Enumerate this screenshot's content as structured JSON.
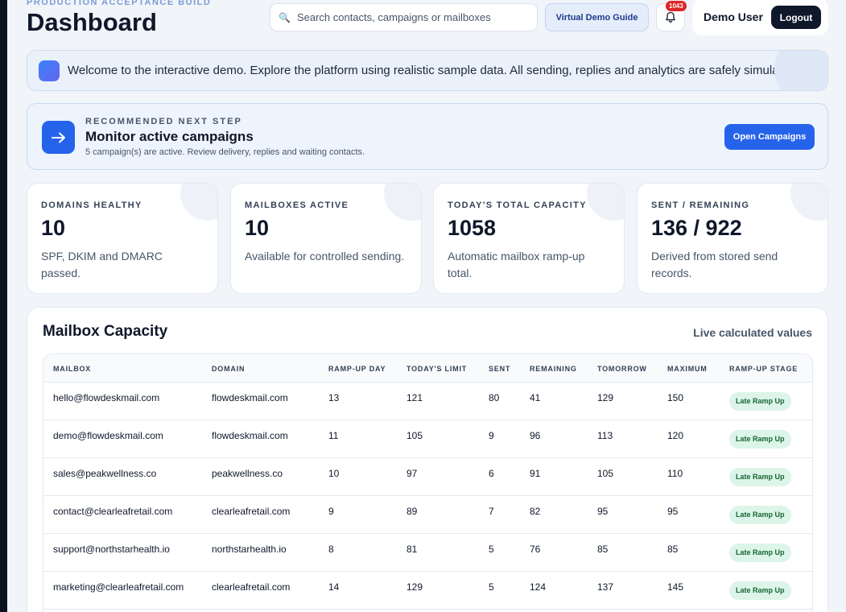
{
  "header": {
    "eyebrow": "PRODUCTION ACCEPTANCE BUILD",
    "title": "Dashboard",
    "search_placeholder": "Search contacts, campaigns or mailboxes",
    "guide_label": "Virtual Demo Guide",
    "notification_count": "1043",
    "user_name": "Demo User",
    "logout_label": "Logout"
  },
  "welcome": {
    "text": "Welcome to the interactive demo. Explore the platform using realistic sample data. All sending, replies and analytics are safely simulated."
  },
  "recommend": {
    "eyebrow": "RECOMMENDED NEXT STEP",
    "title": "Monitor active campaigns",
    "subtitle": "5 campaign(s) are active. Review delivery, replies and waiting contacts.",
    "button_label": "Open Campaigns"
  },
  "stats": [
    {
      "label": "DOMAINS HEALTHY",
      "value": "10",
      "desc": "SPF, DKIM and DMARC passed."
    },
    {
      "label": "MAILBOXES ACTIVE",
      "value": "10",
      "desc": "Available for controlled sending."
    },
    {
      "label": "TODAY'S TOTAL CAPACITY",
      "value": "1058",
      "desc": "Automatic mailbox ramp-up total."
    },
    {
      "label": "SENT / REMAINING",
      "value": "136 / 922",
      "desc": "Derived from stored send records."
    }
  ],
  "capacity": {
    "title": "Mailbox Capacity",
    "live_label": "Live calculated values",
    "columns": [
      "MAILBOX",
      "DOMAIN",
      "RAMP-UP DAY",
      "TODAY'S LIMIT",
      "SENT",
      "REMAINING",
      "TOMORROW",
      "MAXIMUM",
      "RAMP-UP STAGE"
    ],
    "rows": [
      {
        "mailbox": "hello@flowdeskmail.com",
        "domain": "flowdeskmail.com",
        "day": "13",
        "limit": "121",
        "sent": "80",
        "remaining": "41",
        "tomorrow": "129",
        "maximum": "150",
        "stage": "Late Ramp Up"
      },
      {
        "mailbox": "demo@flowdeskmail.com",
        "domain": "flowdeskmail.com",
        "day": "11",
        "limit": "105",
        "sent": "9",
        "remaining": "96",
        "tomorrow": "113",
        "maximum": "120",
        "stage": "Late Ramp Up"
      },
      {
        "mailbox": "sales@peakwellness.co",
        "domain": "peakwellness.co",
        "day": "10",
        "limit": "97",
        "sent": "6",
        "remaining": "91",
        "tomorrow": "105",
        "maximum": "110",
        "stage": "Late Ramp Up"
      },
      {
        "mailbox": "contact@clearleafretail.com",
        "domain": "clearleafretail.com",
        "day": "9",
        "limit": "89",
        "sent": "7",
        "remaining": "82",
        "tomorrow": "95",
        "maximum": "95",
        "stage": "Late Ramp Up"
      },
      {
        "mailbox": "support@northstarhealth.io",
        "domain": "northstarhealth.io",
        "day": "8",
        "limit": "81",
        "sent": "5",
        "remaining": "76",
        "tomorrow": "85",
        "maximum": "85",
        "stage": "Late Ramp Up"
      },
      {
        "mailbox": "marketing@clearleafretail.com",
        "domain": "clearleafretail.com",
        "day": "14",
        "limit": "129",
        "sent": "5",
        "remaining": "124",
        "tomorrow": "137",
        "maximum": "145",
        "stage": "Late Ramp Up"
      }
    ]
  },
  "colors": {
    "accent": "#2563eb",
    "dark": "#0f172a",
    "stage_bg": "#dcf5e8",
    "stage_text": "#166534"
  }
}
